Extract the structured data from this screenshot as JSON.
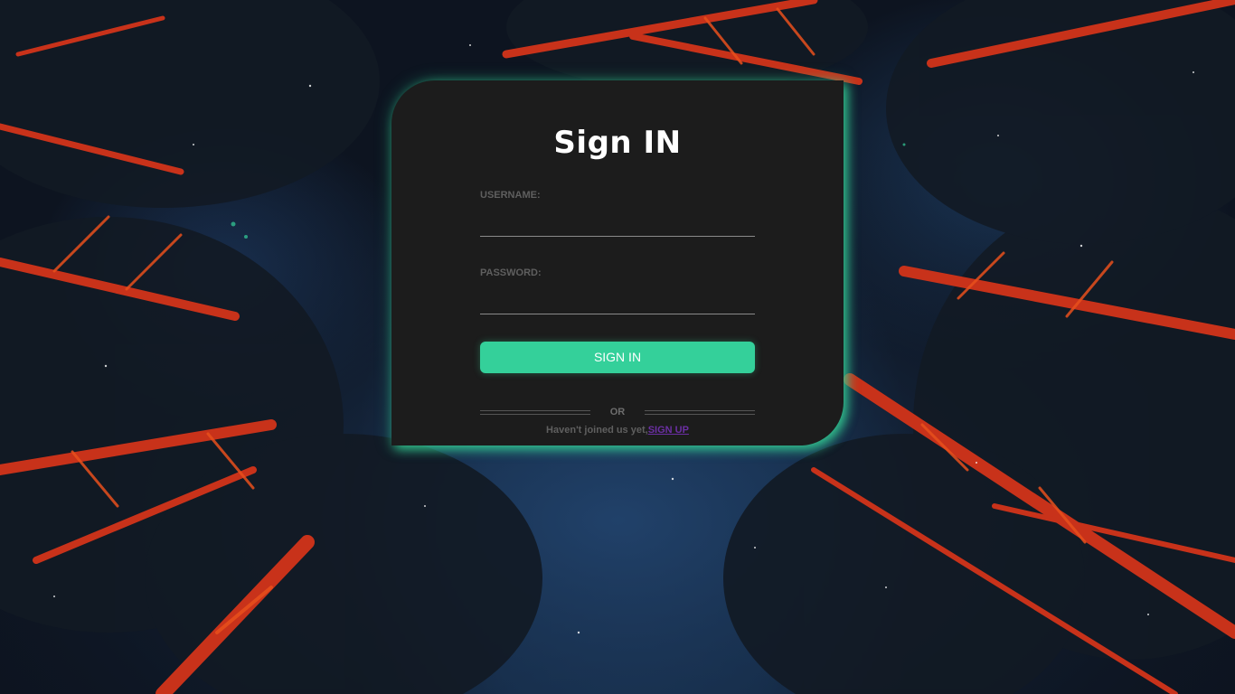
{
  "colors": {
    "accent": "#34d09a",
    "card_background": "#1c1c1c",
    "link": "#6b2fa3",
    "page_background": "#0d1420"
  },
  "background": {
    "description_icon": "night-forest-photo"
  },
  "login": {
    "title": "Sign IN",
    "username_label": "USERNAME:",
    "username_value": "",
    "password_label": "PASSWORD:",
    "password_value": "",
    "submit_label": "SIGN IN",
    "divider_text": "OR",
    "signup_prompt": "Haven't joined us yet,",
    "signup_link": "SIGN UP"
  }
}
